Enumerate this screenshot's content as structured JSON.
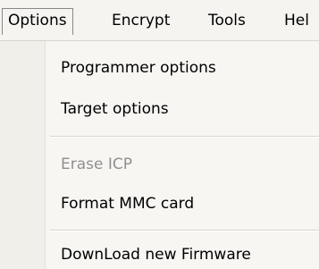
{
  "menubar": {
    "items": [
      {
        "label": "Options"
      },
      {
        "label": "Encrypt"
      },
      {
        "label": "Tools"
      },
      {
        "label": "Hel"
      }
    ]
  },
  "menu": {
    "items": [
      {
        "label": "Programmer options",
        "enabled": true
      },
      {
        "label": "Target options",
        "enabled": true
      },
      {
        "label": "Erase ICP",
        "enabled": false
      },
      {
        "label": "Format MMC card",
        "enabled": true
      },
      {
        "label": "DownLoad new Firmware",
        "enabled": true
      }
    ]
  },
  "colors": {
    "menubar_bg": "#f5f4f1",
    "menu_bg": "#f7f6f3",
    "disabled_text": "#8f8f8f"
  }
}
